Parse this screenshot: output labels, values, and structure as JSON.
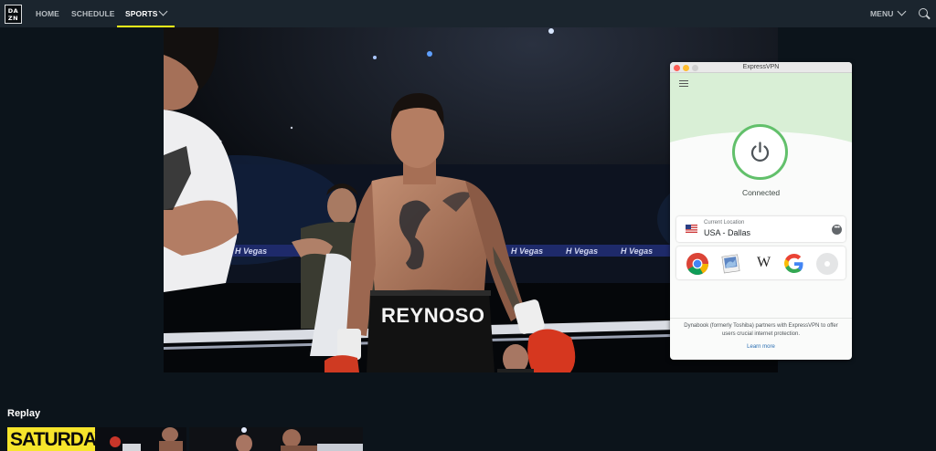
{
  "topnav": {
    "logo": [
      "DA",
      "ZN"
    ],
    "items": [
      {
        "label": "HOME",
        "active": false
      },
      {
        "label": "SCHEDULE",
        "active": false
      },
      {
        "label": "SPORTS",
        "active": true
      }
    ],
    "menu_label": "MENU",
    "icons": [
      "chevron-down-icon",
      "search-icon"
    ],
    "accent": "#f7ff1a"
  },
  "video": {
    "trunks_text": "REYNOSO",
    "banner_text": "H Vegas"
  },
  "vpn": {
    "window_title": "ExpressVPN",
    "status": "Connected",
    "location_label": "Current Location",
    "location": "USA - Dallas",
    "more_icon": "ellipsis-icon",
    "shortcuts": [
      "chrome-icon",
      "mail-icon",
      "wikipedia-icon",
      "google-icon",
      "add-shortcut-icon"
    ],
    "wiki_glyph": "W",
    "partner_text": "Dynabook (formerly Toshiba) partners with ExpressVPN to offer users crucial internet protection.",
    "learn_more": "Learn more",
    "accent": "#62c06b"
  },
  "replay": {
    "heading": "Replay",
    "thumb_text": "SATURDAY"
  }
}
